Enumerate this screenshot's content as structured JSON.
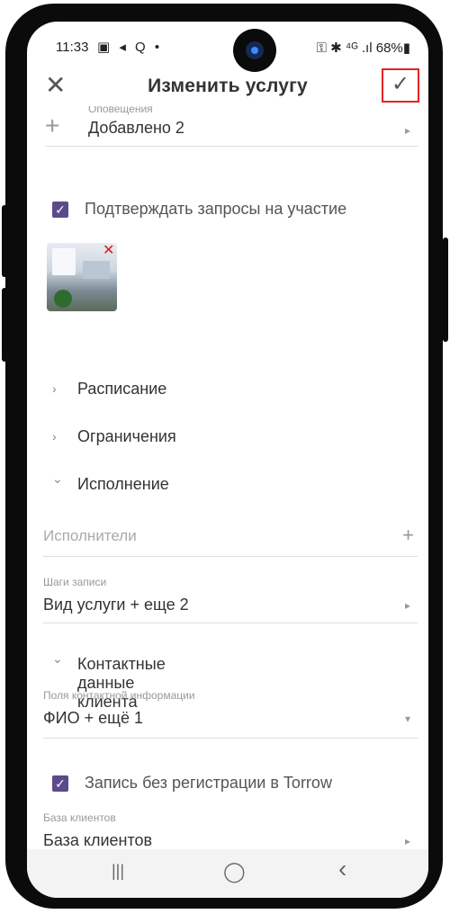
{
  "status": {
    "time": "11:33",
    "left_icons": "▣ ◂ Q •",
    "right_icons": "⚿ ✱ ⁴ᴳ .ıl 68%▮"
  },
  "appbar": {
    "close": "✕",
    "title": "Изменить услугу",
    "save": "✓"
  },
  "notifications": {
    "label": "Оповещения",
    "value": "Добавлено 2",
    "plus": "+",
    "arrow": "▸"
  },
  "confirm": {
    "checkbox": "✓",
    "label": "Подтверждать запросы на участие"
  },
  "photo": {
    "remove": "✕"
  },
  "sections": {
    "schedule": {
      "chev": "›",
      "label": "Расписание"
    },
    "limits": {
      "chev": "›",
      "label": "Ограничения"
    },
    "execution": {
      "chev": "⌄",
      "label": "Исполнение"
    },
    "contacts": {
      "chev": "⌄",
      "label": "Контактные данные клиента"
    }
  },
  "performers": {
    "placeholder": "Исполнители",
    "plus": "+"
  },
  "steps": {
    "label": "Шаги записи",
    "value": "Вид услуги + еще 2",
    "arrow": "▸"
  },
  "contact_fields": {
    "label": "Поля контактной информации",
    "value": "ФИО + ещё 1",
    "arrow": "▾"
  },
  "no_registration": {
    "checkbox": "✓",
    "label": "Запись без регистрации в Torrow"
  },
  "client_base": {
    "label": "База клиентов",
    "value": "База клиентов",
    "arrow": "▸"
  },
  "nav": {
    "recent": "|||",
    "home": "◯",
    "back": "‹"
  }
}
